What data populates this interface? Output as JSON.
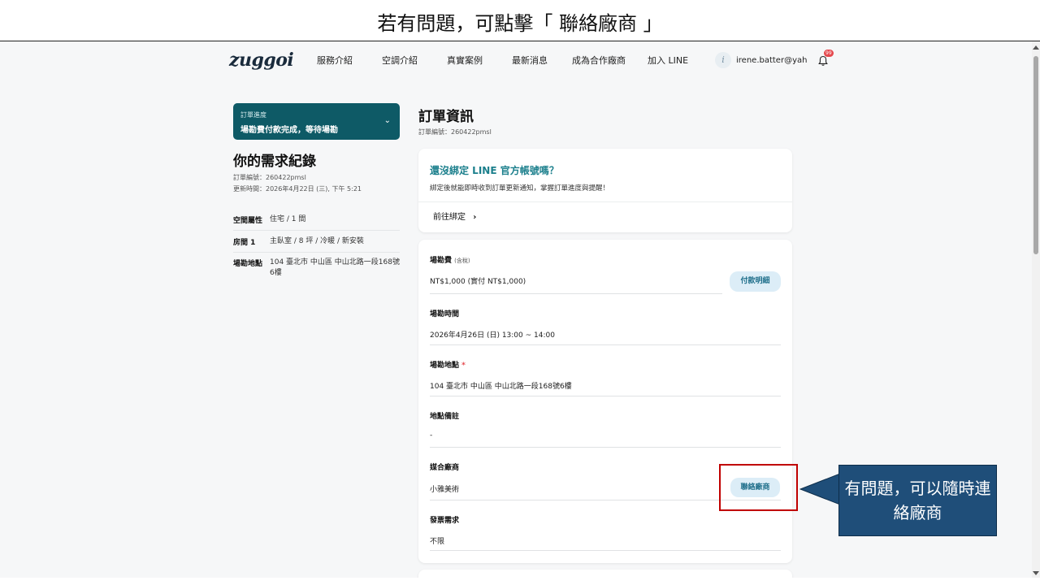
{
  "slide": {
    "title": "若有問題，可點擊「 聯絡廠商 」"
  },
  "nav": {
    "logo": "zuggoi",
    "items": [
      "服務介紹",
      "空調介紹",
      "真實案例",
      "最新消息",
      "成為合作廠商",
      "加入 LINE"
    ],
    "user_initial": "i",
    "user_name": "irene.batter@yah…",
    "notification_count": "99"
  },
  "left": {
    "progress_label": "訂單進度",
    "progress_value": "場勘費付款完成，等待場勘",
    "title": "你的需求紀錄",
    "order_no": "訂單編號：260422pmsl",
    "updated": "更新時間：2026年4月22日 (三), 下午 5:21",
    "rows": [
      {
        "key": "空間屬性",
        "value": "住宅 / 1 間"
      },
      {
        "key": "房間 1",
        "value": "主臥室 / 8 坪 / 冷暖 / 新安裝"
      },
      {
        "key": "場勘地點",
        "value": "104 臺北市 中山區 中山北路一段168號6樓"
      }
    ]
  },
  "order": {
    "title": "訂單資訊",
    "order_no": "訂單編號：260422pmsl",
    "line_card": {
      "title": "還沒綁定 LINE 官方帳號嗎？",
      "desc": "綁定後就能即時收到訂單更新通知，掌握訂單進度與提醒！",
      "link": "前往綁定"
    },
    "fields": {
      "fee_label": "場勘費",
      "fee_tax": "(含稅)",
      "fee_value": "NT$1,000 (實付 NT$1,000)",
      "pay_detail_button": "付款明細",
      "time_label": "場勘時間",
      "time_value": "2026年4月26日 (日) 13:00 ~ 14:00",
      "location_label": "場勘地點",
      "location_required": "*",
      "location_value": "104 臺北市 中山區 中山北路一段168號6樓",
      "note_label": "地點備註",
      "note_value": "-",
      "vendor_label": "媒合廠商",
      "vendor_value": "小雅美術",
      "contact_button": "聯絡廠商",
      "invoice_label": "發票需求",
      "invoice_value": "不限"
    }
  },
  "callout": {
    "text": "有問題，可以隨時連絡廠商"
  },
  "colors": {
    "teal": "#0e5a66",
    "link_teal": "#1b7f8c",
    "callout_blue": "#1f4e79",
    "highlight_red": "#c00000"
  }
}
